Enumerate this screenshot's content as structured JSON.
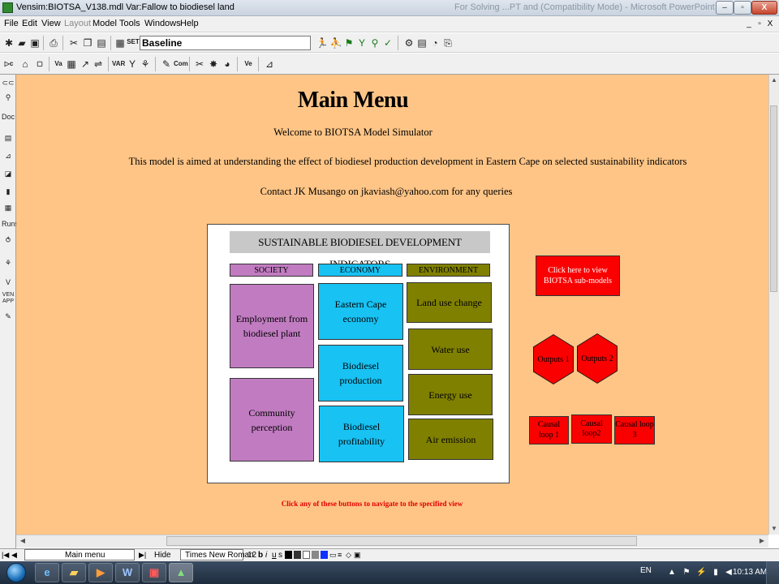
{
  "window": {
    "title": "Vensim:BIOTSA_V138.mdl Var:Fallow to biodiesel land",
    "title_ghost": "For Solving ...PT and (Compatibility Mode) - Microsoft PowerPoint",
    "controls": {
      "minimize": "–",
      "maximize": "▫",
      "close": "X"
    }
  },
  "menubar": {
    "items": [
      "File",
      "Edit",
      "View",
      "Layout",
      "Model",
      "Tools",
      "Windows",
      "Help"
    ],
    "disabled": [
      "Layout"
    ],
    "mdi_controls": [
      "_",
      "▫",
      "X"
    ]
  },
  "toolbar": {
    "set_label": "SET",
    "run_name": "Baseline"
  },
  "left_strip": {
    "labels": [
      "Doc",
      "Runs",
      "VEN APP"
    ]
  },
  "view": {
    "title": "Main Menu",
    "welcome": "Welcome to BIOTSA Model Simulator",
    "aim": "This model is aimed at understanding the effect of biodiesel production development in Eastern Cape on selected sustainability indicators",
    "contact": "Contact JK Musango on jkaviash@yahoo.com for any queries",
    "panel_title": "SUSTAINABLE BIODIESEL DEVELOPMENT INDICATORS",
    "headers": {
      "society": "SOCIETY",
      "economy": "ECONOMY",
      "environment": "ENVIRONMENT"
    },
    "society": [
      "Employment from biodiesel plant",
      "Community perception"
    ],
    "economy": [
      "Eastern Cape economy",
      "Biodiesel production",
      "Biodiesel profitability"
    ],
    "environment": [
      "Land use change",
      "Water use",
      "Energy use",
      "Air emission"
    ],
    "submodels_button": "Click here to view BIOTSA sub-models",
    "outputs": [
      "Outputs 1",
      "Outputs 2"
    ],
    "causal_loops": [
      "Causal loop 1",
      "Causal loop2",
      "Causal loop 3"
    ],
    "nav_hint": "Click any of these buttons to navigate to the specified view",
    "colors": {
      "background": "#ffc586",
      "society": "#c17cc1",
      "economy": "#18c2f3",
      "environment": "#808000",
      "nav_button": "#fb0000"
    }
  },
  "statusbar": {
    "view_name": "Main menu",
    "hide": "Hide",
    "font": "Times New Roman",
    "font_size": "12",
    "styles": [
      "b",
      "i",
      "u",
      "s"
    ]
  },
  "taskbar": {
    "language": "EN",
    "time": "10:13 AM",
    "apps": [
      "ie-icon",
      "explorer-icon",
      "media-player-icon",
      "word-icon",
      "pdf-icon",
      "vensim-icon"
    ]
  }
}
